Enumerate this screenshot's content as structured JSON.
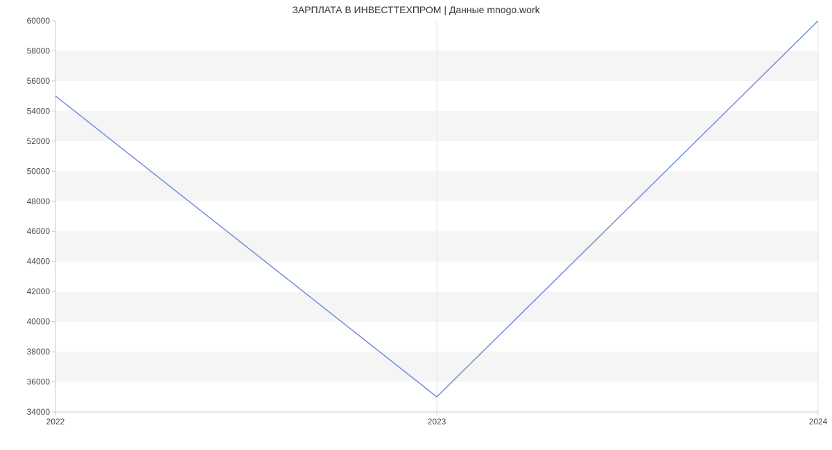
{
  "chart_data": {
    "type": "line",
    "title": "ЗАРПЛАТА В ИНВЕСТТЕХПРОМ | Данные mnogo.work",
    "x": [
      "2022",
      "2023",
      "2024"
    ],
    "values": [
      55000,
      35000,
      60000
    ],
    "xlabel": "",
    "ylabel": "",
    "xlim": [
      "2022",
      "2024"
    ],
    "ylim": [
      34000,
      60000
    ],
    "y_ticks": [
      34000,
      36000,
      38000,
      40000,
      42000,
      44000,
      46000,
      48000,
      50000,
      52000,
      54000,
      56000,
      58000,
      60000
    ],
    "x_ticks": [
      "2022",
      "2023",
      "2024"
    ],
    "colors": {
      "line": "#6f8fd9",
      "band": "#f5f5f5"
    }
  }
}
